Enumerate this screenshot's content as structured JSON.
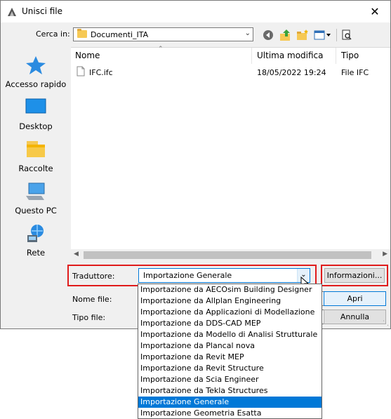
{
  "window": {
    "title": "Unisci file",
    "close_glyph": "✕"
  },
  "lookin": {
    "label": "Cerca in:",
    "value": "Documenti_ITA"
  },
  "toolbar_icons": [
    "back-icon",
    "up-folder-icon",
    "new-folder-icon",
    "view-menu-icon",
    "preview-icon"
  ],
  "sidebar": {
    "items": [
      {
        "label": "Accesso rapido",
        "icon": "star-icon"
      },
      {
        "label": "Desktop",
        "icon": "desktop-icon"
      },
      {
        "label": "Raccolte",
        "icon": "libraries-icon"
      },
      {
        "label": "Questo PC",
        "icon": "computer-icon"
      },
      {
        "label": "Rete",
        "icon": "network-icon"
      }
    ]
  },
  "filelist": {
    "columns": [
      "Nome",
      "Ultima modifica",
      "Tipo"
    ],
    "rows": [
      {
        "name": "IFC.ifc",
        "modified": "18/05/2022 19:24",
        "type": "File IFC"
      }
    ]
  },
  "translator": {
    "label": "Traduttore:",
    "value": "Importazione Generale",
    "info_button": "Informazioni..."
  },
  "filename": {
    "label": "Nome file:"
  },
  "filetype": {
    "label": "Tipo file:"
  },
  "buttons": {
    "open": "Apri",
    "cancel": "Annulla"
  },
  "dropdown": {
    "options": [
      "Importazione da AECOsim Building Designer",
      "Importazione da Allplan Engineering",
      "Importazione da Applicazioni di Modellazione",
      "Importazione da DDS-CAD MEP",
      "Importazione da Modello di Analisi Strutturale",
      "Importazione da Plancal nova",
      "Importazione da Revit MEP",
      "Importazione da Revit Structure",
      "Importazione da Scia Engineer",
      "Importazione da Tekla Structures",
      "Importazione Generale",
      "Importazione Geometria Esatta"
    ],
    "selected_index": 10
  },
  "colors": {
    "selection": "#0078d7",
    "highlight_border": "#e01b1b"
  }
}
